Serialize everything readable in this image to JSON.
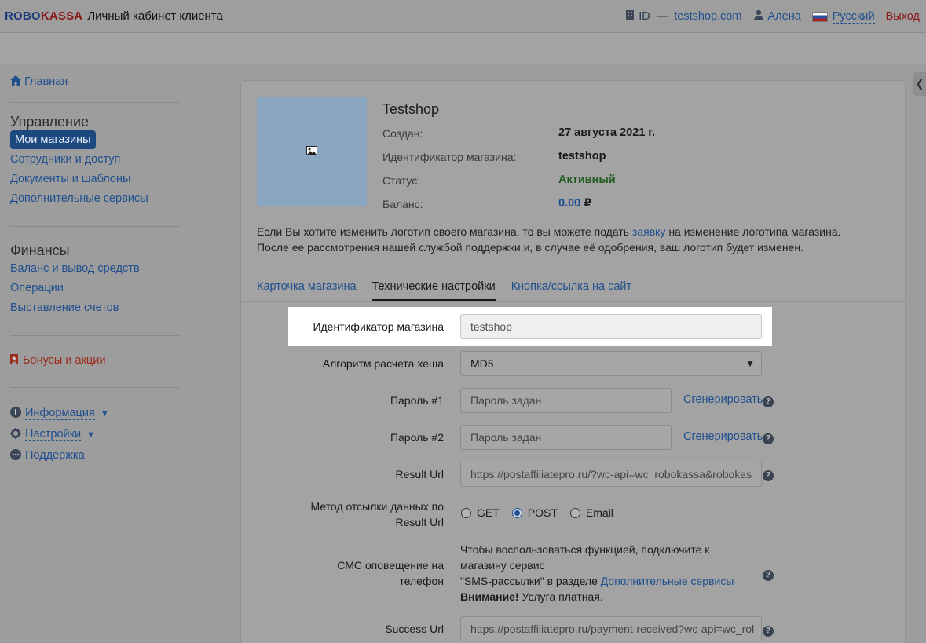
{
  "header": {
    "logo_robo": "ROBO",
    "logo_kassa": "KASSA",
    "title": "Личный кабинет клиента",
    "id_label": "ID",
    "id_dash": "—",
    "shop_domain": "testshop.com",
    "user_name": "Алена",
    "language": "Русский",
    "logout": "Выход"
  },
  "sidebar": {
    "home": "Главная",
    "management_heading": "Управление",
    "management_items": [
      "Мои магазины",
      "Сотрудники и доступ",
      "Документы и шаблоны",
      "Дополнительные сервисы"
    ],
    "finance_heading": "Финансы",
    "finance_items": [
      "Баланс и вывод средств",
      "Операции",
      "Выставление счетов"
    ],
    "bonus": "Бонусы и акции",
    "info": "Информация",
    "settings": "Настройки",
    "support": "Поддержка"
  },
  "shop": {
    "name": "Testshop",
    "created_label": "Создан:",
    "created_value": "27 августа 2021 г.",
    "id_label": "Идентификатор магазина:",
    "id_value": "testshop",
    "status_label": "Статус:",
    "status_value": "Активный",
    "balance_label": "Баланс:",
    "balance_value": "0.00",
    "currency": "₽",
    "desc_part1": "Если Вы хотите изменить логотип своего магазина, то вы можете подать ",
    "desc_link": "заявку",
    "desc_part2": " на изменение логотипа магазина.",
    "desc_line2": "После ее рассмотрения нашей службой поддержки и, в случае её одобрения, ваш логотип будет изменен.",
    "colors": {
      "status": "#1f5a1f",
      "link": "#1f4f8f"
    }
  },
  "tabs": [
    "Карточка магазина",
    "Технические настройки",
    "Кнопка/ссылка на сайт"
  ],
  "form": {
    "shop_id_label": "Идентификатор магазина",
    "shop_id_value": "testshop",
    "hash_label": "Алгоритм расчета хеша",
    "hash_value": "MD5",
    "pass1_label": "Пароль #1",
    "pass1_placeholder": "Пароль задан",
    "pass2_label": "Пароль #2",
    "pass2_placeholder": "Пароль задан",
    "generate": "Сгенерировать",
    "result_url_label": "Result Url",
    "result_url_value": "https://postaffiliatepro.ru/?wc-api=wc_robokassa&robokas",
    "method_label_1": "Метод отсылки данных по",
    "method_label_2": "Result Url",
    "method_options": [
      "GET",
      "POST",
      "Email"
    ],
    "method_selected": "POST",
    "sms_label_1": "СМС оповещение на",
    "sms_label_2": "телефон",
    "sms_text_1": "Чтобы воспользоваться функцией, подключите к",
    "sms_text_2": "магазину сервис",
    "sms_text_3": "\"SMS-рассылки\" в разделе ",
    "sms_text_link": "Дополнительные сервисы",
    "sms_warning_bold": "Внимание!",
    "sms_warning_rest": " Услуга платная.",
    "success_url_label": "Success Url",
    "success_url_value": "https://postaffiliatepro.ru/payment-received?wc-api=wc_rol"
  }
}
